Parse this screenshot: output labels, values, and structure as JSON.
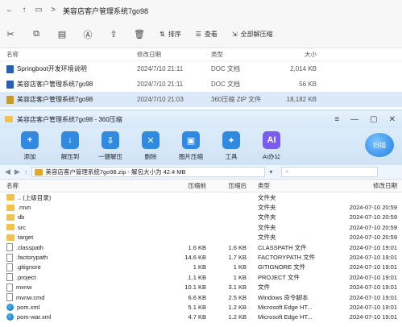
{
  "explorer": {
    "breadcrumb_sep": ">",
    "breadcrumb": "美容店客户管理系统7go98",
    "toolbar": {
      "sort": "排序",
      "view": "查看",
      "select_all": "全部解压缩"
    },
    "columns": {
      "name": "名称",
      "date": "修改日期",
      "type": "类型",
      "size": "大小"
    },
    "files": [
      {
        "name": "Springboot开发环境说明",
        "date": "2024/7/10 21:11",
        "type": "DOC 文档",
        "size": "2,014 KB",
        "icon_color": "#2b5fb5"
      },
      {
        "name": "美容店客户管理系统7go98",
        "date": "2024/7/10 21:11",
        "type": "DOC 文档",
        "size": "56 KB",
        "icon_color": "#2b5fb5"
      },
      {
        "name": "美容店客户管理系统7go98",
        "date": "2024/7/10 21:03",
        "type": "360压缩 ZIP 文件",
        "size": "18,182 KB",
        "icon_color": "#c59a2a"
      }
    ]
  },
  "archive": {
    "title": "美容店客户管理系统7go98 - 360压缩",
    "toolbar": [
      {
        "label": "添加",
        "icon": "add-icon",
        "color": "#2f8ae0",
        "glyph": "+"
      },
      {
        "label": "解压到",
        "icon": "extract-to-icon",
        "color": "#2f8ae0",
        "glyph": "↓"
      },
      {
        "label": "一键解压",
        "icon": "one-click-extract-icon",
        "color": "#2f8ae0",
        "glyph": "⇩"
      },
      {
        "label": "删除",
        "icon": "delete-icon",
        "color": "#2f8ae0",
        "glyph": "✕"
      },
      {
        "label": "图片压缩",
        "icon": "image-compress-icon",
        "color": "#2f8ae0",
        "glyph": "▣"
      },
      {
        "label": "工具",
        "icon": "tools-icon",
        "color": "#2f8ae0",
        "glyph": "✦"
      },
      {
        "label": "AI办公",
        "icon": "ai-office-icon",
        "color": "#7a5cf0",
        "glyph": "AI"
      }
    ],
    "scan_label": "扫描",
    "path": "美容店客户管理系统7go98.zip - 解包大小为 42.4 MB",
    "columns": {
      "name": "名称",
      "compressed": "压缩前",
      "original": "压缩后",
      "type": "类型",
      "date": "修改日期"
    },
    "rows": [
      {
        "name": ".. (上级目录)",
        "compressed": "",
        "original": "",
        "type": "文件夹",
        "date": "",
        "kind": "folder"
      },
      {
        "name": ".mvn",
        "compressed": "",
        "original": "",
        "type": "文件夹",
        "date": "2024-07-10 20:59",
        "kind": "folder"
      },
      {
        "name": "db",
        "compressed": "",
        "original": "",
        "type": "文件夹",
        "date": "2024-07-10 20:59",
        "kind": "folder"
      },
      {
        "name": "src",
        "compressed": "",
        "original": "",
        "type": "文件夹",
        "date": "2024-07-10 20:59",
        "kind": "folder"
      },
      {
        "name": "target",
        "compressed": "",
        "original": "",
        "type": "文件夹",
        "date": "2024-07-10 20:59",
        "kind": "folder"
      },
      {
        "name": ".classpath",
        "compressed": "1.6 KB",
        "original": "1.6 KB",
        "type": "CLASSPATH 文件",
        "date": "2024-07-10 19:01",
        "kind": "doc"
      },
      {
        "name": ".factorypath",
        "compressed": "14.6 KB",
        "original": "1.7 KB",
        "type": "FACTORYPATH 文件",
        "date": "2024-07-10 19:01",
        "kind": "doc"
      },
      {
        "name": ".gitignore",
        "compressed": "1 KB",
        "original": "1 KB",
        "type": "GITIGNORE 文件",
        "date": "2024-07-10 19:01",
        "kind": "doc"
      },
      {
        "name": ".project",
        "compressed": "1.1 KB",
        "original": "1 KB",
        "type": "PROJECT 文件",
        "date": "2024-07-10 19:01",
        "kind": "doc"
      },
      {
        "name": "mvnw",
        "compressed": "10.1 KB",
        "original": "3.1 KB",
        "type": "文件",
        "date": "2024-07-10 19:01",
        "kind": "doc"
      },
      {
        "name": "mvnw.cmd",
        "compressed": "6.6 KB",
        "original": "2.5 KB",
        "type": "Windows 命令脚本",
        "date": "2024-07-10 19:01",
        "kind": "doc"
      },
      {
        "name": "pom.xml",
        "compressed": "5.1 KB",
        "original": "1.2 KB",
        "type": "Microsoft Edge HT...",
        "date": "2024-07-10 19:01",
        "kind": "web"
      },
      {
        "name": "pom-war.xml",
        "compressed": "4.7 KB",
        "original": "1.2 KB",
        "type": "Microsoft Edge HT...",
        "date": "2024-07-10 19:01",
        "kind": "web"
      }
    ]
  }
}
